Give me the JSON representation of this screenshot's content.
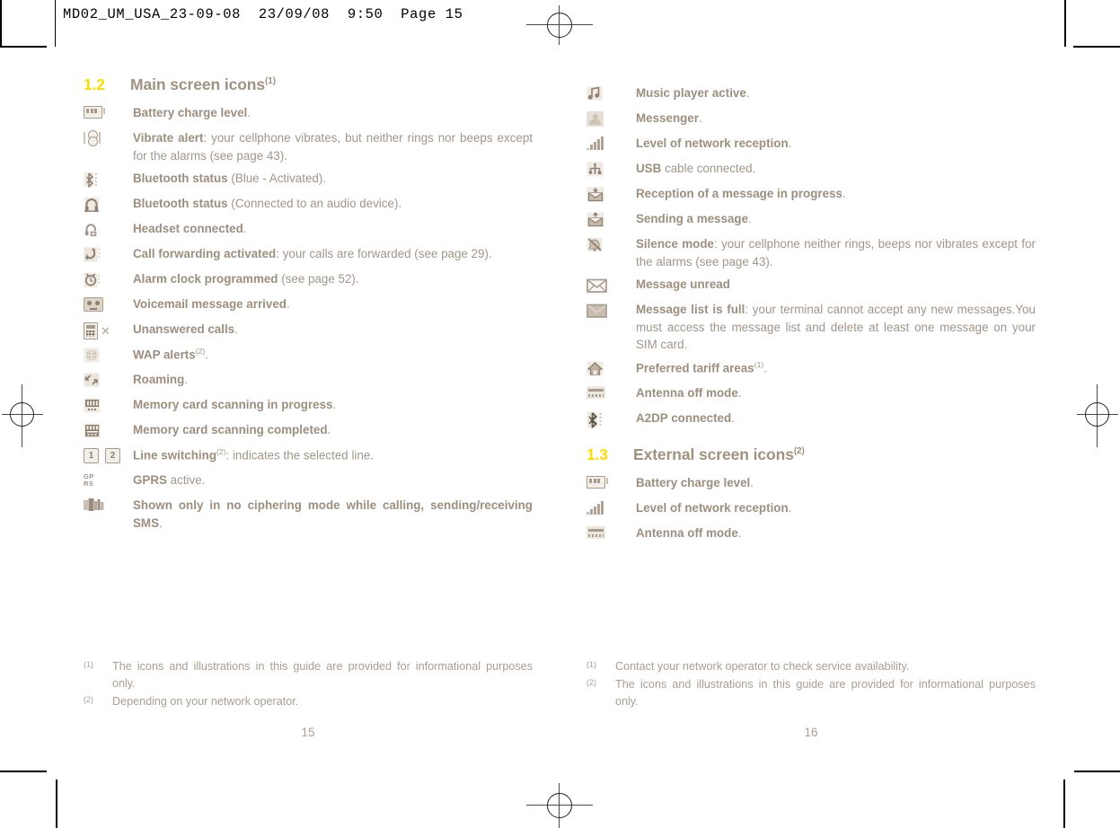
{
  "print_marks": {
    "slug_text": "MD02_UM_USA_23-09-08  23/09/08  9:50  Page 15"
  },
  "colors": {
    "section_number": "#ffd900",
    "heading": "#a0927f",
    "body_text": "#a3958a",
    "icon": "#a89a8c"
  },
  "left_page": {
    "section": {
      "number": "1.2",
      "title": "Main screen icons",
      "sup": "(1)"
    },
    "items": [
      {
        "icon": "battery-icon",
        "bold": "Battery charge level",
        "rest": "."
      },
      {
        "icon": "vibrate-alert-icon",
        "bold": "Vibrate alert",
        "rest": ": your cellphone vibrates, but neither rings nor beeps except for the alarms (see page 43)."
      },
      {
        "icon": "bluetooth-icon",
        "bold": "Bluetooth status",
        "rest": " (Blue - Activated)."
      },
      {
        "icon": "bluetooth-audio-icon",
        "bold": "Bluetooth status",
        "rest": " (Connected to an audio device)."
      },
      {
        "icon": "headset-icon",
        "bold": "Headset connected",
        "rest": "."
      },
      {
        "icon": "call-forwarding-icon",
        "bold": "Call forwarding activated",
        "rest": ": your calls are forwarded (see page 29)."
      },
      {
        "icon": "alarm-clock-icon",
        "bold": "Alarm clock programmed",
        "rest": " (see page 52)."
      },
      {
        "icon": "voicemail-icon",
        "bold": "Voicemail message arrived",
        "rest": "."
      },
      {
        "icon": "unanswered-calls-icon",
        "bold": "Unanswered calls",
        "rest": "."
      },
      {
        "icon": "wap-alerts-icon",
        "bold": "WAP alerts",
        "sup": "(2)",
        "rest": "."
      },
      {
        "icon": "roaming-icon",
        "bold": "Roaming",
        "rest": "."
      },
      {
        "icon": "memory-card-scanning-icon",
        "bold": "Memory card scanning in progress",
        "rest": "."
      },
      {
        "icon": "memory-card-complete-icon",
        "bold": "Memory card scanning completed",
        "rest": "."
      },
      {
        "icon": "line-switching-icon",
        "bold": "Line switching",
        "sup": "(2)",
        "rest": ": indicates the selected line."
      },
      {
        "icon": "gprs-icon",
        "bold": "GPRS",
        "rest": " active."
      },
      {
        "icon": "no-ciphering-icon",
        "bold": "Shown only in no ciphering mode while calling, sending/receiving",
        "rest": " SMS.",
        "bold_tail": "SMS"
      }
    ],
    "footnotes": [
      {
        "mark": "(1)",
        "text": "The icons and illustrations in this guide are provided for informational purposes only."
      },
      {
        "mark": "(2)",
        "text": "Depending on your network operator."
      }
    ],
    "page_number": "15"
  },
  "right_page": {
    "items_top": [
      {
        "icon": "music-player-icon",
        "bold": "Music player active",
        "rest": "."
      },
      {
        "icon": "messenger-icon",
        "bold": "Messenger",
        "rest": "."
      },
      {
        "icon": "signal-bars-icon",
        "bold": "Level of network reception",
        "rest": "."
      },
      {
        "icon": "usb-cable-icon",
        "bold": "USB",
        "rest": " cable connected."
      },
      {
        "icon": "message-receiving-icon",
        "bold": "Reception of a message in progress",
        "rest": "."
      },
      {
        "icon": "message-sending-icon",
        "bold": "Sending a message",
        "rest": "."
      },
      {
        "icon": "silence-mode-icon",
        "bold": "Silence mode",
        "rest": ": your cellphone neither rings, beeps nor vibrates except for the alarms (see page 43)."
      },
      {
        "icon": "message-unread-icon",
        "bold": "Message unread",
        "rest": ""
      },
      {
        "icon": "message-list-full-icon",
        "bold": "Message list is full",
        "rest": ": your terminal cannot accept any new messages.You must access the message list and delete at least one message on your SIM card."
      },
      {
        "icon": "preferred-tariff-icon",
        "bold": "Preferred tariff areas",
        "sup": "(1)",
        "rest": "."
      },
      {
        "icon": "antenna-off-icon",
        "bold": "Antenna off mode",
        "rest": "."
      },
      {
        "icon": "a2dp-icon",
        "bold": "A2DP connected",
        "rest": "."
      }
    ],
    "section": {
      "number": "1.3",
      "title": "External screen icons",
      "sup": "(2)"
    },
    "items_bottom": [
      {
        "icon": "battery-icon",
        "bold": "Battery charge level",
        "rest": "."
      },
      {
        "icon": "signal-bars-icon",
        "bold": "Level of network reception",
        "rest": "."
      },
      {
        "icon": "antenna-off-icon",
        "bold": "Antenna off mode",
        "rest": "."
      }
    ],
    "footnotes": [
      {
        "mark": "(1)",
        "text": "Contact your network operator to check service availability."
      },
      {
        "mark": "(2)",
        "text": "The icons and illustrations in this guide are provided for informational purposes only."
      }
    ],
    "page_number": "16"
  }
}
